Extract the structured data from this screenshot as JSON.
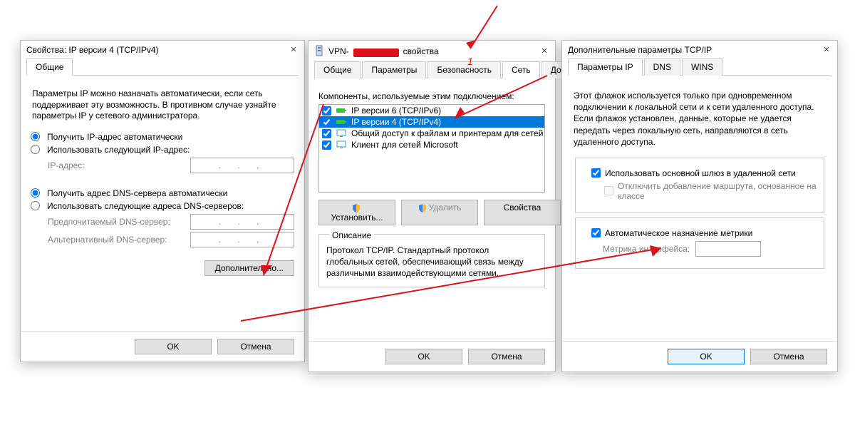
{
  "win1": {
    "title": "Свойства: IP версии 4 (TCP/IPv4)",
    "tabs": {
      "general": "Общие"
    },
    "info": "Параметры IP можно назначать автоматически, если сеть поддерживает эту возможность. В противном случае узнайте параметры IP у сетевого администратора.",
    "radio": {
      "auto_ip": "Получить IP-адрес автоматически",
      "manual_ip": "Использовать следующий IP-адрес:",
      "auto_dns": "Получить адрес DNS-сервера автоматически",
      "manual_dns": "Использовать следующие адреса DNS-серверов:"
    },
    "fields": {
      "ip": "IP-адрес:",
      "dns1": "Предпочитаемый DNS-сервер:",
      "dns2": "Альтернативный DNS-сервер:"
    },
    "ip_placeholder": ".   .   .",
    "advanced": "Дополнительно...",
    "ok": "OK",
    "cancel": "Отмена"
  },
  "win2": {
    "title_prefix": "VPN-",
    "title_suffix": " свойства",
    "tabs": {
      "general": "Общие",
      "params": "Параметры",
      "security": "Безопасность",
      "network": "Сеть",
      "access": "Доступ"
    },
    "components_label": "Компоненты, используемые этим подключением:",
    "items": [
      "IP версии 6 (TCP/IPv6)",
      "IP версии 4 (TCP/IPv4)",
      "Общий доступ к файлам и принтерам для сетей Micr...",
      "Клиент для сетей Microsoft"
    ],
    "install": "Установить...",
    "remove": "Удалить",
    "properties": "Свойства",
    "desc_title": "Описание",
    "desc_body": "Протокол TCP/IP. Стандартный протокол глобальных сетей, обеспечивающий связь между различными взаимодействующими сетями.",
    "ok": "OK",
    "cancel": "Отмена"
  },
  "win3": {
    "title": "Дополнительные параметры TCP/IP",
    "tabs": {
      "ip": "Параметры IP",
      "dns": "DNS",
      "wins": "WINS"
    },
    "intro": "Этот флажок используется только при одновременном подключении к локальной сети и к сети удаленного доступа. Если флажок установлен, данные, которые не удается передать через локальную сеть, направляются в сеть удаленного доступа.",
    "gw_checkbox": "Использовать основной шлюз в удаленной сети",
    "gw_sub": "Отключить добавление маршрута, основанное на классе",
    "metric_auto": "Автоматическое назначение метрики",
    "metric_label": "Метрика интерфейса:",
    "ok": "OK",
    "cancel": "Отмена"
  },
  "annotation": {
    "label1": "1"
  }
}
